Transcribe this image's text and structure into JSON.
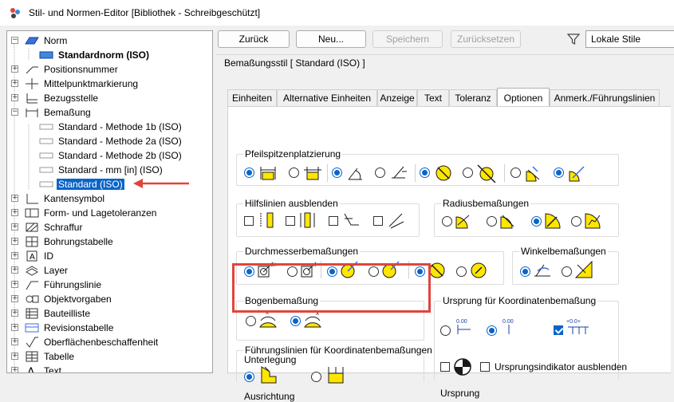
{
  "window": {
    "title": "Stil- und Normen-Editor [Bibliothek - Schreibgeschützt]"
  },
  "tree": {
    "items": [
      {
        "label": "Norm",
        "icon": "norm-icon",
        "expander": "minus",
        "level": 0
      },
      {
        "label": "Standardnorm (ISO)",
        "icon": "norm-standard-icon",
        "bold": true,
        "level": 1
      },
      {
        "label": "Positionsnummer",
        "icon": "balloon-icon",
        "expander": "plus",
        "level": 0
      },
      {
        "label": "Mittelpunktmarkierung",
        "icon": "center-mark-icon",
        "expander": "plus",
        "level": 0
      },
      {
        "label": "Bezugsstelle",
        "icon": "datum-icon",
        "expander": "plus",
        "level": 0
      },
      {
        "label": "Bemaßung",
        "icon": "dimension-icon",
        "expander": "minus",
        "level": 0
      },
      {
        "label": "Standard - Methode 1b (ISO)",
        "icon": "dim-style-icon",
        "level": 1
      },
      {
        "label": "Standard - Methode 2a (ISO)",
        "icon": "dim-style-icon",
        "level": 1
      },
      {
        "label": "Standard - Methode 2b (ISO)",
        "icon": "dim-style-icon",
        "level": 1
      },
      {
        "label": "Standard - mm [in] (ISO)",
        "icon": "dim-style-icon",
        "level": 1
      },
      {
        "label": "Standard (ISO)",
        "icon": "dim-style-icon",
        "level": 1,
        "selected": true
      },
      {
        "label": "Kantensymbol",
        "icon": "edge-symbol-icon",
        "expander": "plus",
        "level": 0
      },
      {
        "label": "Form- und Lagetoleranzen",
        "icon": "fcf-icon",
        "expander": "plus",
        "level": 0
      },
      {
        "label": "Schraffur",
        "icon": "hatch-icon",
        "expander": "plus",
        "level": 0
      },
      {
        "label": "Bohrungstabelle",
        "icon": "hole-table-icon",
        "expander": "plus",
        "level": 0
      },
      {
        "label": "ID",
        "icon": "id-icon",
        "expander": "plus",
        "level": 0
      },
      {
        "label": "Layer",
        "icon": "layer-icon",
        "expander": "plus",
        "level": 0
      },
      {
        "label": "Führungslinie",
        "icon": "leader-icon",
        "expander": "plus",
        "level": 0
      },
      {
        "label": "Objektvorgaben",
        "icon": "object-defaults-icon",
        "expander": "plus",
        "level": 0
      },
      {
        "label": "Bauteilliste",
        "icon": "parts-list-icon",
        "expander": "plus",
        "level": 0
      },
      {
        "label": "Revisionstabelle",
        "icon": "revision-table-icon",
        "expander": "plus",
        "level": 0
      },
      {
        "label": "Oberflächenbeschaffenheit",
        "icon": "surface-texture-icon",
        "expander": "plus",
        "level": 0
      },
      {
        "label": "Tabelle",
        "icon": "table-icon",
        "expander": "plus",
        "level": 0
      },
      {
        "label": "Text",
        "icon": "text-icon",
        "expander": "plus",
        "level": 0
      }
    ]
  },
  "toolbar": {
    "back": "Zurück",
    "new": "Neu...",
    "save": "Speichern",
    "reset": "Zurücksetzen",
    "filter_value": "Lokale Stile"
  },
  "style_title": "Bemaßungsstil [ Standard (ISO) ]",
  "tabs": [
    {
      "label": "Einheiten",
      "active": false
    },
    {
      "label": "Alternative Einheiten",
      "active": false
    },
    {
      "label": "Anzeige",
      "active": false
    },
    {
      "label": "Text",
      "active": false
    },
    {
      "label": "Toleranz",
      "active": false
    },
    {
      "label": "Optionen",
      "active": true
    },
    {
      "label": "Anmerk./Führungslinien",
      "active": false
    }
  ],
  "groups": {
    "arrowhead": "Pfeilspitzenplatzierung",
    "ext_hide": "Hilfslinien ausblenden",
    "radius": "Radiusbemaßungen",
    "diameter": "Durchmesserbemaßungen",
    "angular": "Winkelbemaßungen",
    "arc": "Bogenbemaßung",
    "ordinate_origin": "Ursprung für Koordinatenbemaßung",
    "ordinate_leaders": "Führungslinien für Koordinatenbemaßungen",
    "underlay": "Unterlegung",
    "alignment": "Ausrichtung",
    "origin": "Ursprung",
    "origin_hide_label": "Ursprungsindikator ausblenden",
    "ordinate_text": "0.00",
    "ordinate_text_2": "+0.0+"
  },
  "colors": {
    "accent": "#0a64c8",
    "highlight": "#e0453c",
    "icon_fill": "#ffe600",
    "icon_stroke": "#1a1a1a"
  }
}
